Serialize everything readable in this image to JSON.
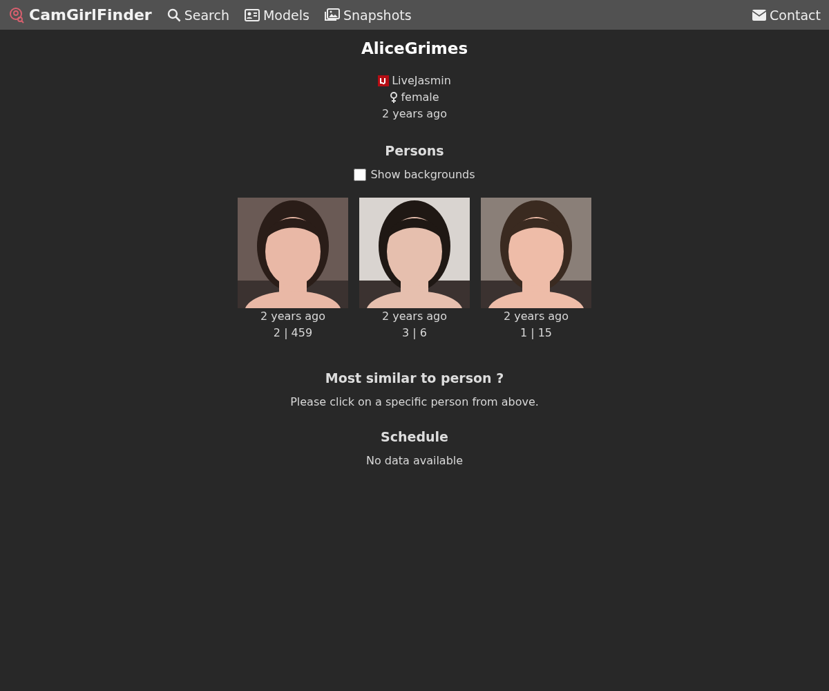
{
  "nav": {
    "brand": "CamGirlFinder",
    "links": [
      {
        "kind": "search",
        "label": "Search"
      },
      {
        "kind": "models",
        "label": "Models"
      },
      {
        "kind": "snapshots",
        "label": "Snapshots"
      }
    ],
    "contact": {
      "kind": "contact",
      "label": "Contact"
    }
  },
  "profile": {
    "name": "AliceGrimes",
    "site": "LiveJasmin",
    "gender": "female",
    "seen": "2 years ago"
  },
  "persons": {
    "title": "Persons",
    "toggle": {
      "label": "Show backgrounds",
      "checked": false
    },
    "items": [
      {
        "time": "2 years ago",
        "counts": "2 | 459"
      },
      {
        "time": "2 years ago",
        "counts": "3 | 6"
      },
      {
        "time": "2 years ago",
        "counts": "1 | 15"
      }
    ]
  },
  "similar": {
    "title": "Most similar to person ?",
    "text": "Please click on a specific person from above."
  },
  "schedule": {
    "title": "Schedule",
    "text": "No data available"
  }
}
